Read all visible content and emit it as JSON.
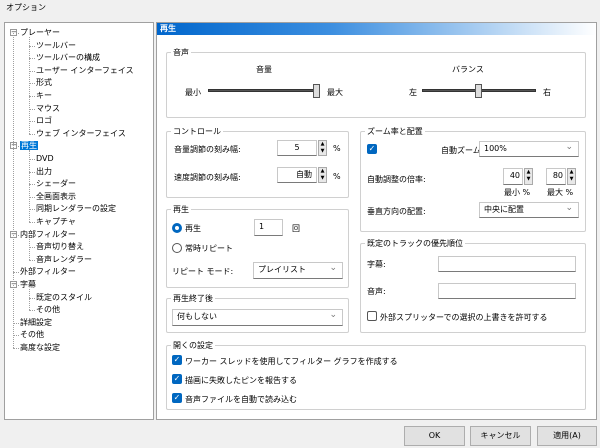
{
  "window": {
    "title": "オプション"
  },
  "tree": [
    {
      "label": "プレーヤー",
      "level": 0,
      "expandable": true
    },
    {
      "label": "ツールバー",
      "level": 1
    },
    {
      "label": "ツールバーの構成",
      "level": 1
    },
    {
      "label": "ユーザー インターフェイス",
      "level": 1
    },
    {
      "label": "形式",
      "level": 1
    },
    {
      "label": "キー",
      "level": 1
    },
    {
      "label": "マウス",
      "level": 1
    },
    {
      "label": "ロゴ",
      "level": 1
    },
    {
      "label": "ウェブ インターフェイス",
      "level": 1
    },
    {
      "label": "再生",
      "level": 0,
      "expandable": true,
      "selected": true
    },
    {
      "label": "DVD",
      "level": 1
    },
    {
      "label": "出力",
      "level": 1
    },
    {
      "label": "シェーダー",
      "level": 1
    },
    {
      "label": "全画面表示",
      "level": 1
    },
    {
      "label": "同期レンダラーの設定",
      "level": 1
    },
    {
      "label": "キャプチャ",
      "level": 1
    },
    {
      "label": "内部フィルター",
      "level": 0,
      "expandable": true
    },
    {
      "label": "音声切り替え",
      "level": 1
    },
    {
      "label": "音声レンダラー",
      "level": 1
    },
    {
      "label": "外部フィルター",
      "level": 0
    },
    {
      "label": "字幕",
      "level": 0,
      "expandable": true
    },
    {
      "label": "既定のスタイル",
      "level": 1
    },
    {
      "label": "その他",
      "level": 1
    },
    {
      "label": "詳細設定",
      "level": 0
    },
    {
      "label": "その他",
      "level": 0
    },
    {
      "label": "高度な設定",
      "level": 0
    }
  ],
  "page": {
    "title": "再生"
  },
  "audio": {
    "title": "音声",
    "volume_label": "音量",
    "min": "最小",
    "max": "最大",
    "volume_value_pct": 98,
    "balance_label": "バランス",
    "left": "左",
    "right": "右",
    "balance_value_pct": 50
  },
  "control": {
    "title": "コントロール",
    "volume_step_label": "音量調節の刻み幅:",
    "volume_step": "5",
    "speed_step_label": "速度調節の刻み幅:",
    "speed_step": "自動",
    "unit": "%"
  },
  "playback": {
    "title": "再生",
    "play_label": "再生",
    "play_count": "1",
    "times": "回",
    "repeat_label": "常時リピート",
    "repeat_mode_label": "リピート モード:",
    "repeat_mode": "プレイリスト",
    "selected": "play"
  },
  "after": {
    "title": "再生終了後",
    "value": "何もしない"
  },
  "zoom": {
    "title": "ズーム率と配置",
    "auto_zoom_checked": true,
    "auto_zoom_label": "自動ズーム:",
    "auto_zoom": "100%",
    "fit_label": "自動調整の倍率:",
    "min_value": "40",
    "max_value": "80",
    "min_label": "最小 %",
    "max_label": "最大 %",
    "vertical_label": "垂直方向の配置:",
    "vertical": "中央に配置"
  },
  "tracks": {
    "title": "既定のトラックの優先順位",
    "subtitle_label": "字幕:",
    "subtitle": "",
    "audio_label": "音声:",
    "audio": "",
    "override_label": "外部スプリッターでの選択の上書きを許可する",
    "override_checked": false
  },
  "open": {
    "title": "開くの設定",
    "options": [
      {
        "label": "ワーカー スレッドを使用してフィルター グラフを作成する",
        "checked": true
      },
      {
        "label": "描画に失敗したピンを報告する",
        "checked": true
      },
      {
        "label": "音声ファイルを自動で読み込む",
        "checked": true
      }
    ]
  },
  "buttons": {
    "ok": "OK",
    "cancel": "キャンセル",
    "apply": "適用(A)"
  },
  "colors": {
    "accent": "#0067c0",
    "selection": "#0078d7"
  }
}
